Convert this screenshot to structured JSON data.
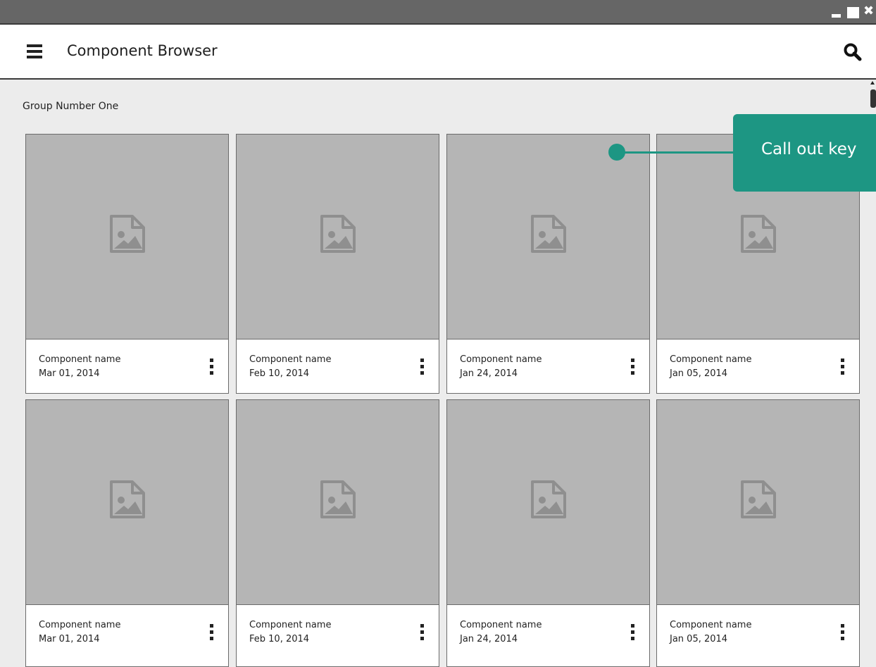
{
  "window": {
    "controls": [
      "minimize-icon",
      "maximize-icon",
      "close-icon"
    ],
    "close_glyph": "✖"
  },
  "appbar": {
    "title": "Component Browser",
    "menu_icon": "hamburger-menu-icon",
    "search_icon": "search-icon"
  },
  "group": {
    "label": "Group Number One"
  },
  "cards": [
    {
      "name": "Component name",
      "date": "Mar 01, 2014"
    },
    {
      "name": "Component name",
      "date": "Feb 10, 2014"
    },
    {
      "name": "Component name",
      "date": "Jan 24, 2014"
    },
    {
      "name": "Component name",
      "date": "Jan 05, 2014"
    },
    {
      "name": "Component name",
      "date": "Mar 01, 2014"
    },
    {
      "name": "Component name",
      "date": "Feb 10, 2014"
    },
    {
      "name": "Component name",
      "date": "Jan 24, 2014"
    },
    {
      "name": "Component name",
      "date": "Jan 05, 2014"
    }
  ],
  "callout": {
    "text": "Call out key"
  },
  "colors": {
    "titlebar": "#666666",
    "accent": "#1d9683",
    "placeholder": "#b5b5b5"
  }
}
